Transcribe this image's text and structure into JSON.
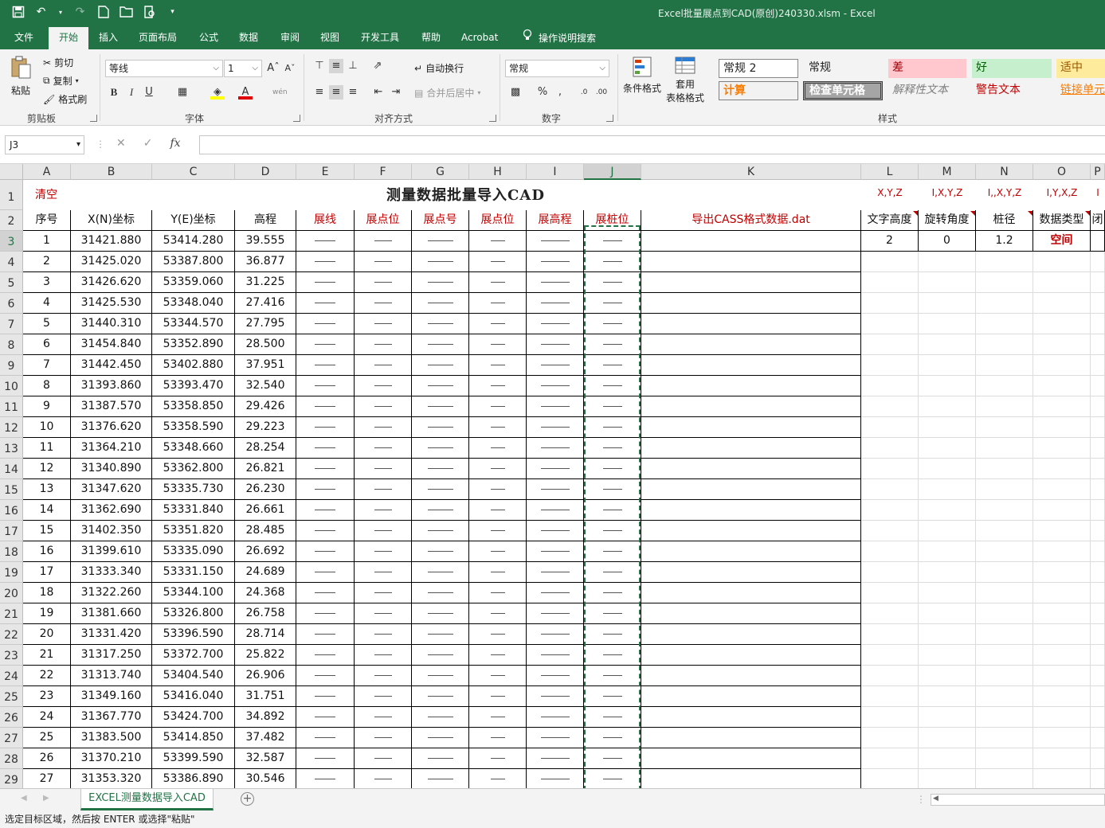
{
  "window": {
    "title": "Excel批量展点到CAD(原创)240330.xlsm  -  Excel"
  },
  "ribbon": {
    "tabs": [
      "文件",
      "开始",
      "插入",
      "页面布局",
      "公式",
      "数据",
      "审阅",
      "视图",
      "开发工具",
      "帮助",
      "Acrobat"
    ],
    "active_tab": "开始",
    "search_label": "操作说明搜索",
    "clipboard": {
      "paste": "粘贴",
      "cut": "剪切",
      "copy": "复制",
      "format_painter": "格式刷",
      "group": "剪贴板"
    },
    "font": {
      "name": "等线",
      "size": "1",
      "group": "字体"
    },
    "alignment": {
      "wrap": "自动换行",
      "merge": "合并后居中",
      "group": "对齐方式"
    },
    "number": {
      "format": "常规",
      "group": "数字"
    },
    "styles_group": {
      "cond_format": "条件格式",
      "table_format_line1": "套用",
      "table_format_line2": "表格格式",
      "group": "样式"
    },
    "cell_styles": [
      "常规 2",
      "常规",
      "差",
      "好",
      "适中",
      "计算",
      "检查单元格",
      "解释性文本",
      "警告文本",
      "链接单元"
    ]
  },
  "formula_bar": {
    "name_box": "J3",
    "formula": ""
  },
  "sheet": {
    "columns": [
      "A",
      "B",
      "C",
      "D",
      "E",
      "F",
      "G",
      "H",
      "I",
      "J",
      "K",
      "L",
      "M",
      "N",
      "O",
      "P"
    ],
    "row_numbers": [
      1,
      2,
      3,
      4,
      5,
      6,
      7,
      8,
      9,
      10,
      11,
      12,
      13,
      14,
      15,
      16,
      17,
      18,
      19,
      20,
      21,
      22,
      23,
      24,
      25,
      26,
      27,
      28,
      29
    ],
    "clear_label": "清空",
    "title": "测量数据批量导入CAD",
    "right_headers": [
      "X,Y,Z",
      "I,X,Y,Z",
      "I,,X,Y,Z",
      "I,Y,X,Z",
      "I"
    ],
    "headers": [
      "序号",
      "X(N)坐标",
      "Y(E)坐标",
      "高程",
      "展线",
      "展点位",
      "展点号",
      "展点位",
      "展高程",
      "展桩位",
      "导出CASS格式数据.dat"
    ],
    "param_headers": [
      "文字高度",
      "旋转角度",
      "桩径",
      "数据类型",
      "闭"
    ],
    "param_values": [
      "2",
      "0",
      "1.2",
      "空间"
    ],
    "rows": [
      [
        "1",
        "31421.880",
        "53414.280",
        "39.555"
      ],
      [
        "2",
        "31425.020",
        "53387.800",
        "36.877"
      ],
      [
        "3",
        "31426.620",
        "53359.060",
        "31.225"
      ],
      [
        "4",
        "31425.530",
        "53348.040",
        "27.416"
      ],
      [
        "5",
        "31440.310",
        "53344.570",
        "27.795"
      ],
      [
        "6",
        "31454.840",
        "53352.890",
        "28.500"
      ],
      [
        "7",
        "31442.450",
        "53402.880",
        "37.951"
      ],
      [
        "8",
        "31393.860",
        "53393.470",
        "32.540"
      ],
      [
        "9",
        "31387.570",
        "53358.850",
        "29.426"
      ],
      [
        "10",
        "31376.620",
        "53358.590",
        "29.223"
      ],
      [
        "11",
        "31364.210",
        "53348.660",
        "28.254"
      ],
      [
        "12",
        "31340.890",
        "53362.800",
        "26.821"
      ],
      [
        "13",
        "31347.620",
        "53335.730",
        "26.230"
      ],
      [
        "14",
        "31362.690",
        "53331.840",
        "26.661"
      ],
      [
        "15",
        "31402.350",
        "53351.820",
        "28.485"
      ],
      [
        "16",
        "31399.610",
        "53335.090",
        "26.692"
      ],
      [
        "17",
        "31333.340",
        "53331.150",
        "24.689"
      ],
      [
        "18",
        "31322.260",
        "53344.100",
        "24.368"
      ],
      [
        "19",
        "31381.660",
        "53326.800",
        "26.758"
      ],
      [
        "20",
        "31331.420",
        "53396.590",
        "28.714"
      ],
      [
        "21",
        "31317.250",
        "53372.700",
        "25.822"
      ],
      [
        "22",
        "31313.740",
        "53404.540",
        "26.906"
      ],
      [
        "23",
        "31349.160",
        "53416.040",
        "31.751"
      ],
      [
        "24",
        "31367.770",
        "53424.700",
        "34.892"
      ],
      [
        "25",
        "31383.500",
        "53414.850",
        "37.482"
      ],
      [
        "26",
        "31370.210",
        "53399.590",
        "32.587"
      ],
      [
        "27",
        "31353.320",
        "53386.890",
        "30.546"
      ]
    ]
  },
  "sheet_tab": "EXCEL测量数据导入CAD",
  "status": "选定目标区域，然后按 ENTER 或选择\"粘贴\""
}
